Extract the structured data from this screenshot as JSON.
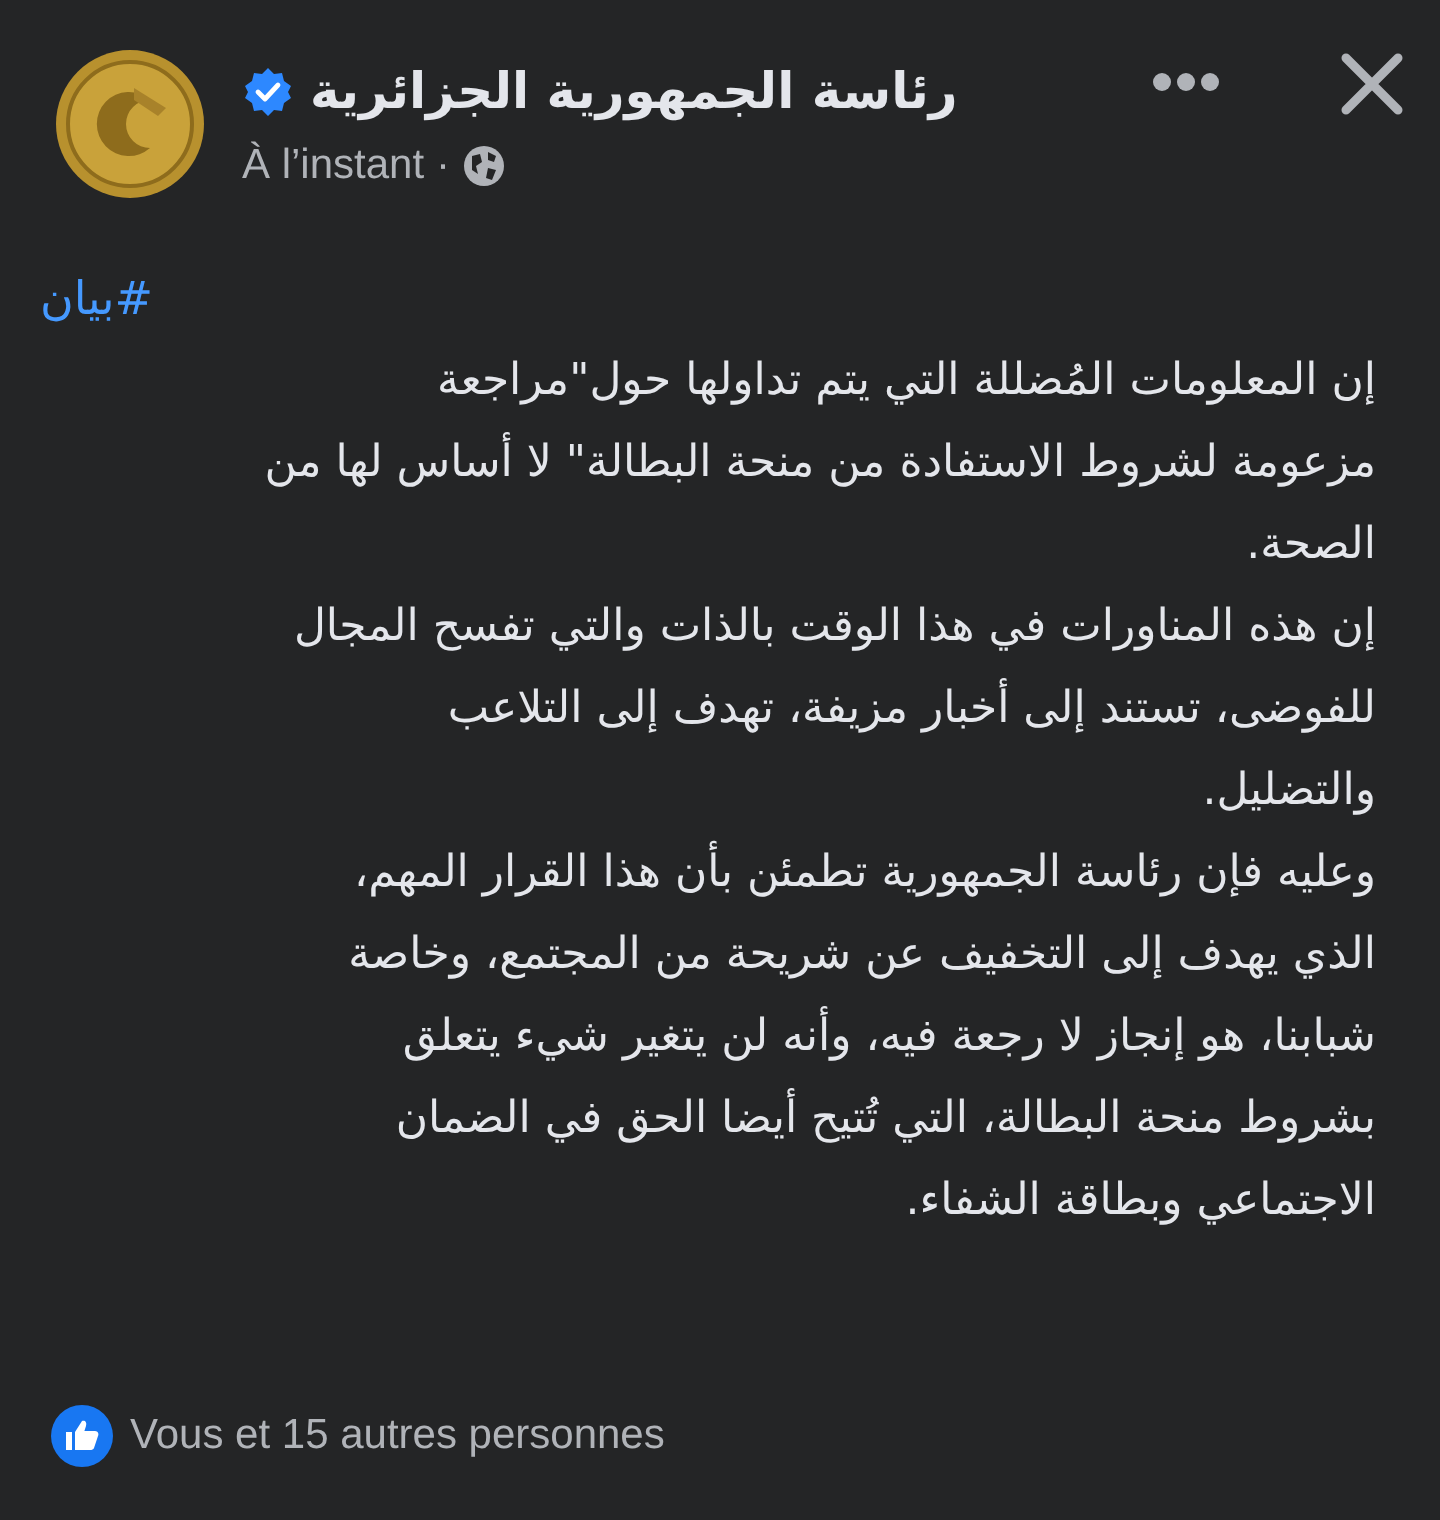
{
  "post": {
    "author": "رئاسة الجمهورية الجزائرية",
    "verified": true,
    "time": "À l’instant",
    "separator": "·",
    "hashtag": "#بيان",
    "paragraphs": [
      [
        "إن المعلومات المُضللة التي يتم تداولها حول\"مراجعة",
        "مزعومة لشروط الاستفادة من منحة البطالة\" لا أساس لها من",
        "الصحة."
      ],
      [
        "إن هذه المناورات في هذا الوقت بالذات والتي تفسح المجال",
        "للفوضى، تستند إلى أخبار مزيفة، تهدف إلى التلاعب",
        "والتضليل."
      ],
      [
        "وعليه فإن رئاسة الجمهورية تطمئن بأن هذا القرار المهم،",
        "الذي يهدف إلى التخفيف عن شريحة من المجتمع، وخاصة",
        "شبابنا، هو إنجاز لا رجعة فيه، وأنه لن يتغير شيء يتعلق",
        "بشروط منحة البطالة، التي تُتيح أيضا الحق في الضمان",
        "الاجتماعي وبطاقة الشفاء."
      ]
    ],
    "reactions": "Vous et 15 autres personnes"
  }
}
